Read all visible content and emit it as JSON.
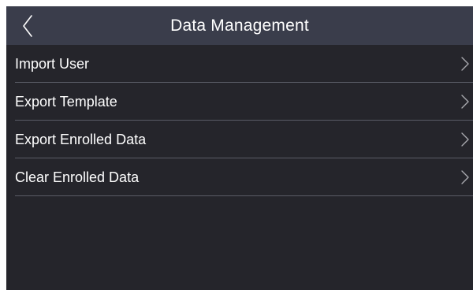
{
  "header": {
    "title": "Data Management",
    "back_icon": "chevron-left-icon"
  },
  "menu": {
    "items": [
      {
        "label": "Import User",
        "icon": "chevron-right-icon"
      },
      {
        "label": "Export Template",
        "icon": "chevron-right-icon"
      },
      {
        "label": "Export Enrolled Data",
        "icon": "chevron-right-icon"
      },
      {
        "label": "Clear Enrolled Data",
        "icon": "chevron-right-icon"
      }
    ]
  },
  "colors": {
    "background": "#25252b",
    "header_background": "#3a3d4b",
    "text": "#ffffff",
    "divider": "#5a5c66",
    "chevron": "#a8a9ae"
  }
}
